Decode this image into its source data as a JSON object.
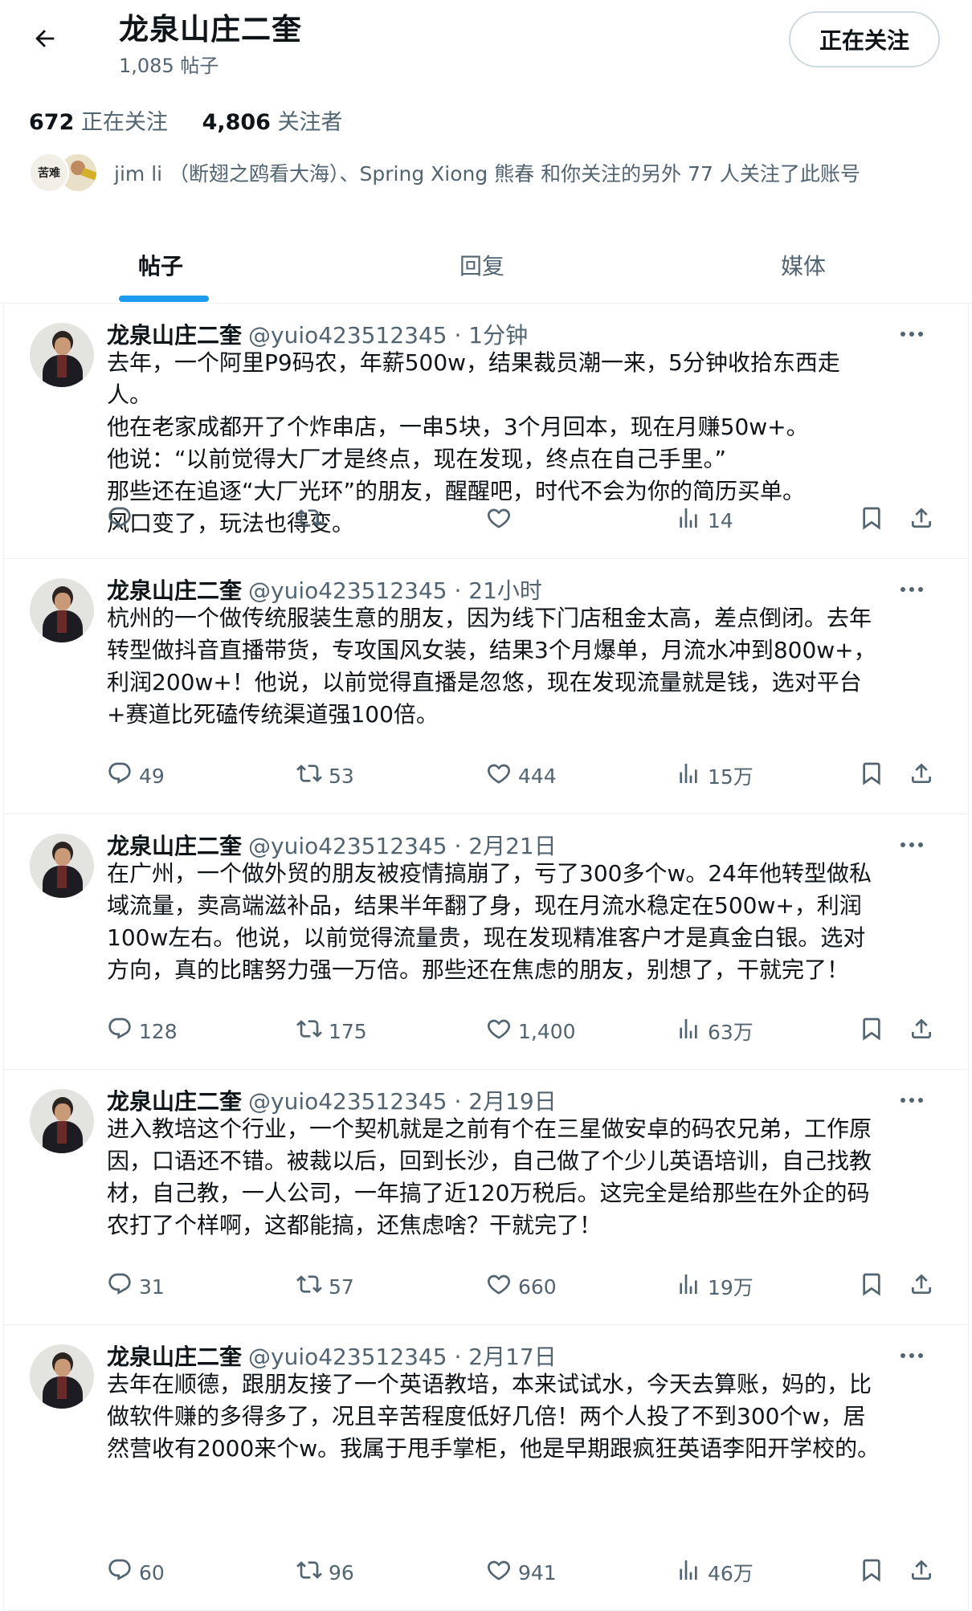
{
  "profile": {
    "name": "龙泉山庄二奎",
    "post_count": "1,085 帖子",
    "follow_button": "正在关注",
    "following_count": "672",
    "following_label": "正在关注",
    "followers_count": "4,806",
    "followers_label": "关注者",
    "mutuals_avatar_text": "苦难",
    "mutuals_text": "jim li （断翅之鸥看大海）、Spring Xiong 熊春 和你关注的另外 77 人关注了此账号"
  },
  "tabs": [
    {
      "label": "帖子",
      "active": true
    },
    {
      "label": "回复",
      "active": false
    },
    {
      "label": "媒体",
      "active": false
    }
  ],
  "colors": {
    "accent": "#1d9bf0",
    "secondary_text": "#536471",
    "border": "#eff3f4"
  },
  "posts": [
    {
      "name": "龙泉山庄二奎",
      "meta": "@yuio423512345 · 1分钟",
      "lines": [
        "去年，一个阿里P9码农，年薪500w，结果裁员潮一来，5分钟收拾东西走",
        "人。",
        "他在老家成都开了个炸串店，一串5块，3个月回本，现在月赚50w+。",
        "他说：“以前觉得大厂才是终点，现在发现，终点在自己手里。”",
        "那些还在追逐“大厂光环”的朋友，醒醒吧，时代不会为你的简历买单。",
        "风口变了，玩法也得变。"
      ],
      "replies": "",
      "reposts": "",
      "likes": "",
      "views": "14"
    },
    {
      "name": "龙泉山庄二奎",
      "meta": "@yuio423512345 · 21小时",
      "lines": [
        "杭州的一个做传统服装生意的朋友，因为线下门店租金太高，差点倒闭。去年",
        "转型做抖音直播带货，专攻国风女装，结果3个月爆单，月流水冲到800w+，",
        "利润200w+！他说，以前觉得直播是忽悠，现在发现流量就是钱，选对平台",
        "+赛道比死磕传统渠道强100倍。"
      ],
      "replies": "49",
      "reposts": "53",
      "likes": "444",
      "views": "15万"
    },
    {
      "name": "龙泉山庄二奎",
      "meta": "@yuio423512345 · 2月21日",
      "lines": [
        "在广州，一个做外贸的朋友被疫情搞崩了，亏了300多个w。24年他转型做私",
        "域流量，卖高端滋补品，结果半年翻了身，现在月流水稳定在500w+，利润",
        "100w左右。他说，以前觉得流量贵，现在发现精准客户才是真金白银。选对",
        "方向，真的比瞎努力强一万倍。那些还在焦虑的朋友，别想了，干就完了！"
      ],
      "replies": "128",
      "reposts": "175",
      "likes": "1,400",
      "views": "63万"
    },
    {
      "name": "龙泉山庄二奎",
      "meta": "@yuio423512345 · 2月19日",
      "lines": [
        "进入教培这个行业，一个契机就是之前有个在三星做安卓的码农兄弟，工作原",
        "因，口语还不错。被裁以后，回到长沙，自己做了个少儿英语培训，自己找教",
        "材，自己教，一人公司，一年搞了近120万税后。这完全是给那些在外企的码",
        "农打了个样啊，这都能搞，还焦虑啥？干就完了！"
      ],
      "replies": "31",
      "reposts": "57",
      "likes": "660",
      "views": "19万"
    },
    {
      "name": "龙泉山庄二奎",
      "meta": "@yuio423512345 · 2月17日",
      "lines": [
        "去年在顺德，跟朋友接了一个英语教培，本来试试水，今天去算账，妈的，比",
        "做软件赚的多得多了，况且辛苦程度低好几倍！两个人投了不到300个w，居",
        "然营收有2000来个w。我属于甩手掌柜，他是早期跟疯狂英语李阳开学校的。"
      ],
      "replies": "60",
      "reposts": "96",
      "likes": "941",
      "views": "46万"
    }
  ]
}
